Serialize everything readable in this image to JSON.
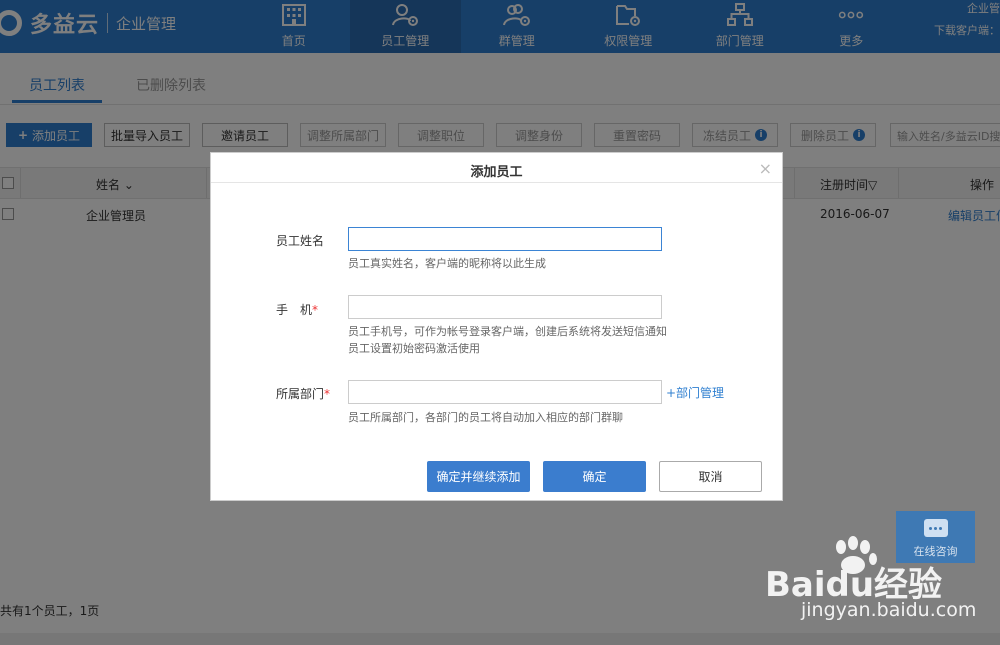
{
  "header": {
    "logo_text": "多益云",
    "logo_sub": "企业管理",
    "nav": [
      {
        "label": "首页",
        "icon": "building-icon"
      },
      {
        "label": "员工管理",
        "icon": "user-gear-icon"
      },
      {
        "label": "群管理",
        "icon": "group-gear-icon"
      },
      {
        "label": "权限管理",
        "icon": "folder-gear-icon"
      },
      {
        "label": "部门管理",
        "icon": "org-chart-icon"
      },
      {
        "label": "更多",
        "icon": "more-icon"
      }
    ],
    "top_right_1": "企业管",
    "top_right_2": "下载客户端："
  },
  "tabs": {
    "active": "员工列表",
    "inactive": "已删除列表"
  },
  "toolbar": {
    "add": "添加员工",
    "batch_import": "批量导入员工",
    "invite": "邀请员工",
    "adjust_dept": "调整所属部门",
    "adjust_post": "调整职位",
    "adjust_identity": "调整身份",
    "reset_password": "重置密码",
    "freeze": "冻结员工",
    "delete": "删除员工",
    "search_placeholder": "输入姓名/多益云ID搜索"
  },
  "table": {
    "col_name": "姓名",
    "col_reg_time": "注册时间",
    "col_action": "操作",
    "rows": [
      {
        "name": "企业管理员",
        "reg_time": "2016-06-07",
        "action": "编辑员工信息"
      }
    ],
    "footer": "共有1个员工，1页"
  },
  "modal": {
    "title": "添加员工",
    "close": "×",
    "name_label": "员工姓名",
    "name_value": "",
    "name_hint": "员工真实姓名，客户端的昵称将以此生成",
    "phone_label": "手　机",
    "phone_value": "",
    "phone_hint": "员工手机号，可作为帐号登录客户端，创建后系统将发送短信通知员工设置初始密码激活使用",
    "dept_label": "所属部门",
    "dept_value": "",
    "dept_link": "+部门管理",
    "dept_hint": "员工所属部门，各部门的员工将自动加入相应的部门群聊",
    "btn_continue": "确定并继续添加",
    "btn_ok": "确定",
    "btn_cancel": "取消"
  },
  "chat_widget": {
    "label": "在线咨询"
  },
  "watermark": {
    "brand": "Baidu经验",
    "url": "jingyan.baidu.com"
  },
  "colors": {
    "brand": "#2f7fd0",
    "nav_active": "#2a6db3",
    "button_blue": "#3b7dce"
  }
}
